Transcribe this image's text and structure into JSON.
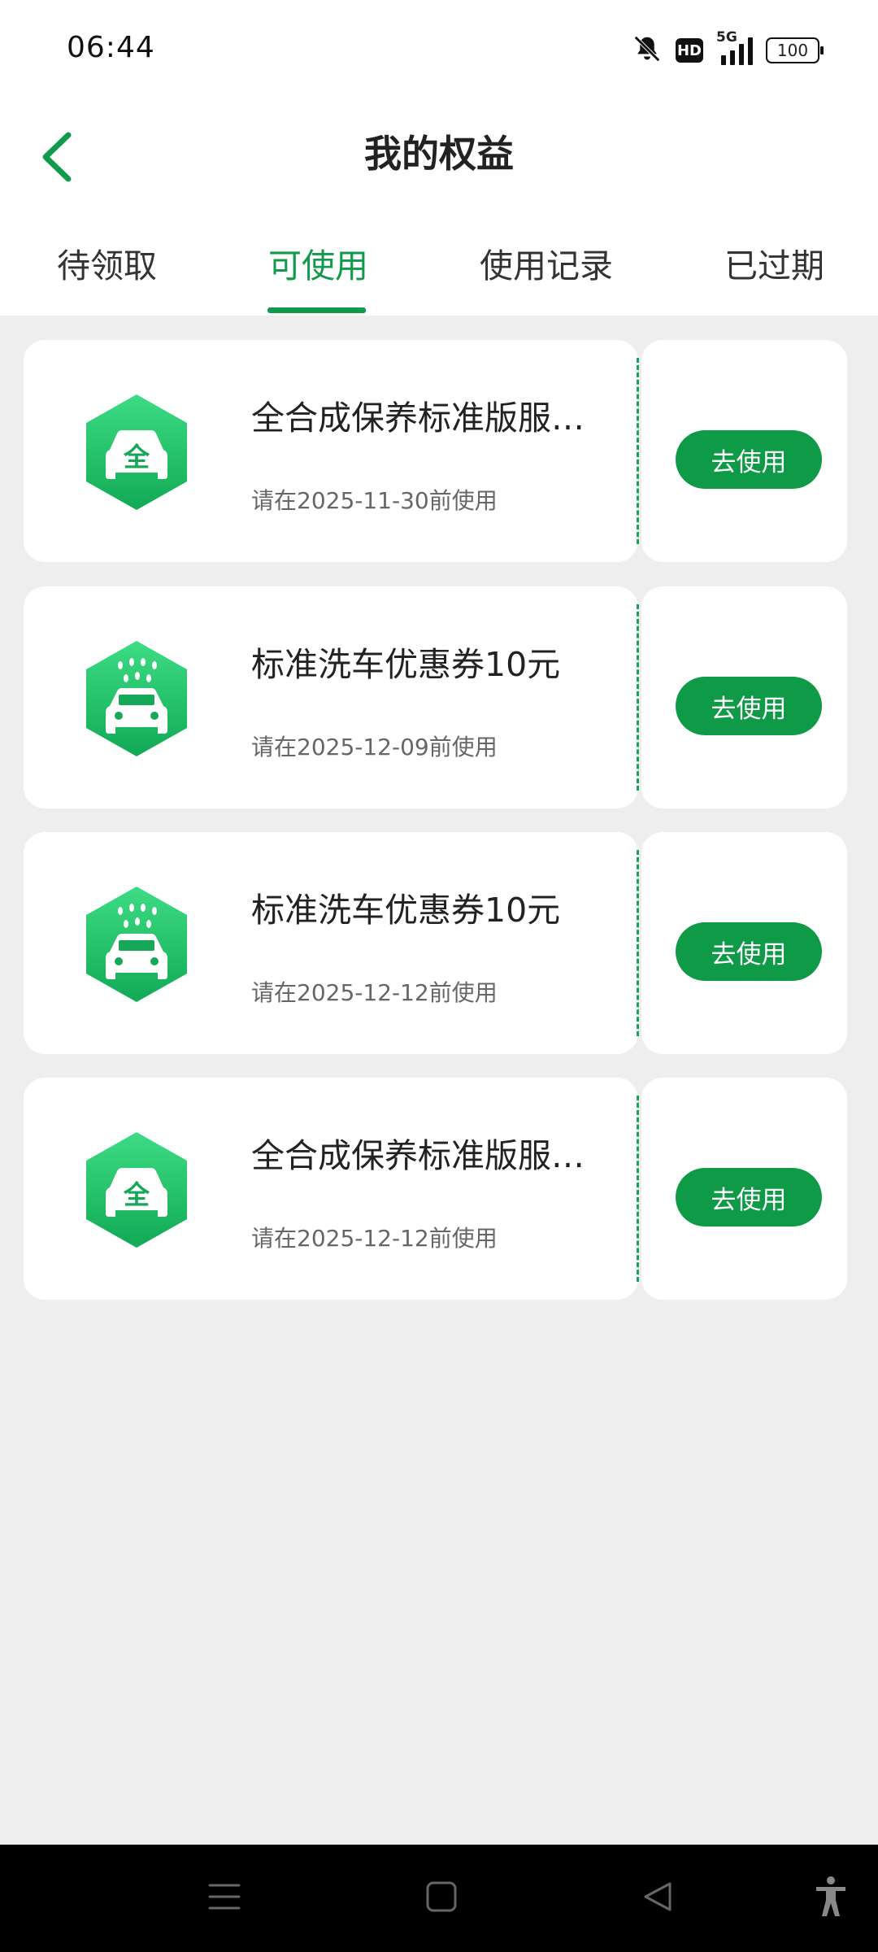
{
  "status_bar": {
    "time": "06:44",
    "hd_label": "HD",
    "network_label": "5G",
    "battery_level": "100"
  },
  "header": {
    "title": "我的权益",
    "back_icon": "chevron-left-icon"
  },
  "tabs": [
    {
      "label": "待领取",
      "active": false
    },
    {
      "label": "可使用",
      "active": true
    },
    {
      "label": "使用记录",
      "active": false
    },
    {
      "label": "已过期",
      "active": false
    }
  ],
  "coupons": [
    {
      "title": "全合成保养标准版服务券",
      "expiry": "请在2025-11-30前使用",
      "icon": "full-synthetic-maintenance-icon",
      "icon_char": "全",
      "button_label": "去使用"
    },
    {
      "title": "标准洗车优惠券10元",
      "expiry": "请在2025-12-09前使用",
      "icon": "car-wash-icon",
      "button_label": "去使用"
    },
    {
      "title": "标准洗车优惠券10元",
      "expiry": "请在2025-12-12前使用",
      "icon": "car-wash-icon",
      "button_label": "去使用"
    },
    {
      "title": "全合成保养标准版服务券",
      "expiry": "请在2025-12-12前使用",
      "icon": "full-synthetic-maintenance-icon",
      "icon_char": "全",
      "button_label": "去使用"
    }
  ],
  "colors": {
    "accent": "#109a4c",
    "button": "#0f9a48",
    "icon_gradient_top": "#3ddc84",
    "icon_gradient_bottom": "#12a955",
    "background": "#eeeeee"
  },
  "nav_bar": {
    "icons": [
      "menu-icon",
      "home-icon",
      "back-triangle-icon",
      "accessibility-icon"
    ]
  }
}
